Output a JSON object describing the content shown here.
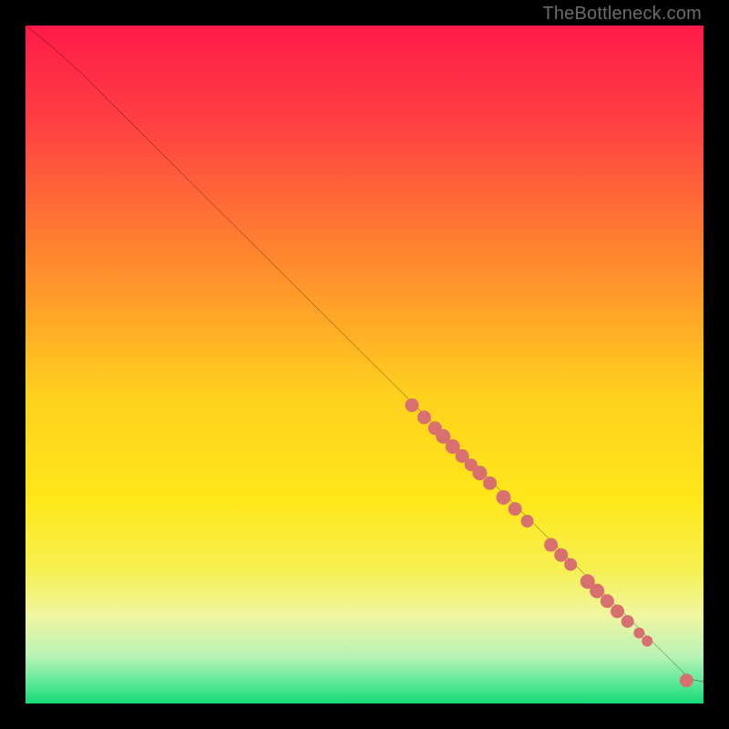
{
  "watermark": "TheBottleneck.com",
  "chart_data": {
    "type": "line",
    "title": "",
    "xlabel": "",
    "ylabel": "",
    "xlim": [
      0,
      100
    ],
    "ylim": [
      0,
      100
    ],
    "grid": false,
    "legend": false,
    "background_gradient_stops": [
      {
        "p": 0,
        "color": "#ff1a49"
      },
      {
        "p": 15,
        "color": "#ff4242"
      },
      {
        "p": 35,
        "color": "#ff8a2e"
      },
      {
        "p": 55,
        "color": "#ffd21d"
      },
      {
        "p": 70,
        "color": "#ffe71a"
      },
      {
        "p": 80,
        "color": "#f6f04f"
      },
      {
        "p": 87,
        "color": "#f0f6a0"
      },
      {
        "p": 93,
        "color": "#b9f2b6"
      },
      {
        "p": 97,
        "color": "#5ae898"
      },
      {
        "p": 100,
        "color": "#16d977"
      }
    ],
    "series": [
      {
        "name": "curve",
        "type": "line",
        "color": "#000000",
        "points_xy": [
          [
            0,
            100
          ],
          [
            4,
            96.8
          ],
          [
            8,
            93.2
          ],
          [
            12,
            89.2
          ],
          [
            98,
            3.6
          ],
          [
            100,
            3.2
          ],
          [
            101.5,
            3.2
          ]
        ]
      },
      {
        "name": "markers",
        "type": "scatter",
        "color": "#d97070",
        "points_xy_r": [
          [
            57.0,
            44.0,
            7.5
          ],
          [
            58.8,
            42.2,
            7.5
          ],
          [
            60.4,
            40.6,
            7.5
          ],
          [
            61.6,
            39.4,
            8.0
          ],
          [
            63.0,
            37.9,
            8.0
          ],
          [
            64.4,
            36.5,
            7.5
          ],
          [
            65.7,
            35.2,
            7.0
          ],
          [
            67.0,
            34.0,
            8.0
          ],
          [
            68.5,
            32.5,
            7.5
          ],
          [
            70.5,
            30.4,
            8.0
          ],
          [
            72.2,
            28.7,
            7.5
          ],
          [
            74.0,
            26.9,
            7.0
          ],
          [
            77.5,
            23.4,
            7.5
          ],
          [
            79.0,
            21.9,
            7.5
          ],
          [
            80.4,
            20.5,
            7.0
          ],
          [
            82.9,
            18.0,
            8.0
          ],
          [
            84.3,
            16.6,
            8.0
          ],
          [
            85.8,
            15.1,
            7.5
          ],
          [
            87.3,
            13.6,
            7.5
          ],
          [
            88.8,
            12.1,
            7.0
          ],
          [
            90.5,
            10.4,
            6.0
          ],
          [
            91.7,
            9.2,
            6.0
          ],
          [
            97.5,
            3.4,
            7.5
          ],
          [
            101.0,
            3.2,
            8.0
          ],
          [
            102.4,
            3.2,
            6.5
          ]
        ]
      }
    ]
  }
}
